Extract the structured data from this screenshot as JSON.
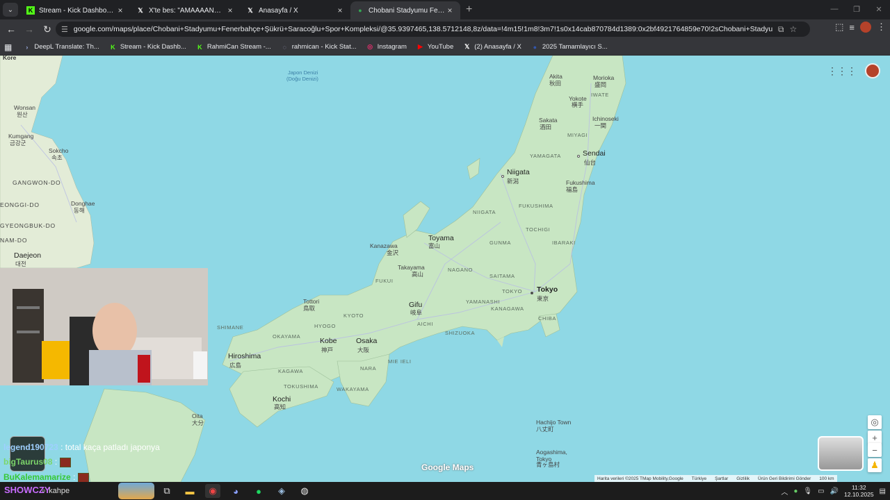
{
  "browser": {
    "tabs": [
      {
        "title": "Stream - Kick Dashboard",
        "icon": "kick-icon",
        "active": false
      },
      {
        "title": "X'te bes: \"AMAAAANN @Ebon",
        "icon": "x-icon",
        "active": false
      },
      {
        "title": "Anasayfa / X",
        "icon": "x-icon",
        "active": false
      },
      {
        "title": "Chobani Stadyumu Fenerbahçe",
        "icon": "maps-pin-icon",
        "active": true
      }
    ],
    "url": "google.com/maps/place/Chobani+Stadyumu+Fenerbahçe+Şükrü+Saracoğlu+Spor+Kompleksi/@35.9397465,138.5712148,8z/data=!4m15!1m8!3m7!1s0x14cab870784d1389:0x2bf4921764859e70!2sChobani+Stadyumu+Fenerbahçe+Şükrü+Sara...",
    "bookmarks": [
      {
        "label": "DeepL Translate: Th...",
        "icon": "deepl-icon"
      },
      {
        "label": "Stream - Kick Dashb...",
        "icon": "kick-icon"
      },
      {
        "label": "RahmiCan Stream -...",
        "icon": "kick-icon"
      },
      {
        "label": "rahmican - Kick Stat...",
        "icon": "kickstats-icon"
      },
      {
        "label": "Instagram",
        "icon": "instagram-icon"
      },
      {
        "label": "YouTube",
        "icon": "youtube-icon"
      },
      {
        "label": "(2) Anasayfa / X",
        "icon": "x-icon"
      },
      {
        "label": "2025 Tamamlayıcı S...",
        "icon": "globe-icon"
      }
    ]
  },
  "map": {
    "labels": {
      "kore": "Kore",
      "sea": "Japon Denizi",
      "sea_alt": "(Doğu Denizi)",
      "wonsan": "Wonsan",
      "wonsan_kr": "원산",
      "kumgang": "Kumgang",
      "kumgang_kr": "금강군",
      "sokcho": "Sokcho",
      "sokcho_kr": "속초",
      "gangwon": "GANGWON-DO",
      "donghae": "Donghae",
      "donghae_kr": "동해",
      "gyeongi": "EONGGI-DO",
      "gyeongbuk": "GYEONGBUK-DO",
      "namdo": "NAM-DO",
      "daejeon": "Daejeon",
      "daejeon_kr": "대전",
      "akita": "Akita",
      "akita_jp": "秋田",
      "morioka": "Morioka",
      "morioka_jp": "盛岡",
      "iwate": "IWATE",
      "yokote": "Yokote",
      "yokote_jp": "横手",
      "ichinoseki": "Ichinoseki",
      "ichinoseki_jp": "一関",
      "sakata": "Sakata",
      "sakata_jp": "酒田",
      "miyagi": "MIYAGI",
      "yamagata": "YAMAGATA",
      "sendai": "Sendai",
      "sendai_jp": "仙台",
      "niigata": "Niigata",
      "niigata_jp": "新潟",
      "fukushima": "Fukushima",
      "fukushima_jp": "福島",
      "niigata_pref": "NIIGATA",
      "fukushima_pref": "FUKUSHIMA",
      "tochigi": "TOCHIGI",
      "gunma": "GUNMA",
      "ibaraki": "IBARAKI",
      "toyama": "Toyama",
      "toyama_jp": "富山",
      "kanazawa": "Kanazawa",
      "kanazawa_jp": "金沢",
      "takayama": "Takayama",
      "takayama_jp": "高山",
      "nagano": "NAGANO",
      "saitama": "SAITAMA",
      "tokyo": "Tokyo",
      "tokyo_jp": "東京",
      "tokyo_pref": "TOKYO",
      "yamanashi": "YAMANASHI",
      "kanagawa": "KANAGAWA",
      "chiba": "CHIBA",
      "fukui": "FUKUI",
      "gifu": "Gifu",
      "gifu_jp": "岐阜",
      "aichi": "AICHI",
      "shizuoka": "SHIZUOKA",
      "tottori": "Tottori",
      "tottori_jp": "鳥取",
      "kyoto": "KYOTO",
      "hyogo": "HYOGO",
      "shimane": "SHIMANE",
      "okayama": "OKAYAMA",
      "kobe": "Kobe",
      "kobe_jp": "神戸",
      "osaka": "Osaka",
      "osaka_jp": "大阪",
      "hiroshima": "Hiroshima",
      "hiroshima_jp": "広島",
      "mie": "MIE IELI",
      "nara": "NARA",
      "kagawa": "KAGAWA",
      "tokushima": "TOKUSHIMA",
      "wakayama": "WAKAYAMA",
      "kochi": "Kochi",
      "kochi_jp": "高知",
      "oita": "Oita",
      "oita_jp": "大分",
      "hachijo": "Hachijo Town",
      "hachijo_jp": "八丈町",
      "aogashima": "Aogashima,",
      "aogashima2": "Tokyo",
      "aogashima_jp": "青ヶ島村"
    },
    "logo": "Google Maps",
    "attribution": [
      "Harita verileri ©2025 TMap Mobility,Google",
      "Türkiye",
      "Şartlar",
      "Gizlilik",
      "Ürün Geri Bildirimi Gönder",
      "100 km"
    ]
  },
  "chat": [
    {
      "user": "legend190723",
      "sep": ":",
      "msg": "total kaça patladı japonya",
      "color": "#9fd0ff"
    },
    {
      "user": "bigTaurus08",
      "sep": ":",
      "msg": "",
      "color": "#7cd66a"
    },
    {
      "user": "BuKalemamarize",
      "sep": ":",
      "msg": "",
      "color": "#36c836"
    }
  ],
  "taskbar": {
    "search_text": "kahpe",
    "overlay_text": "SHOWCZY",
    "time": "11:32",
    "date": "12.10.2025"
  }
}
